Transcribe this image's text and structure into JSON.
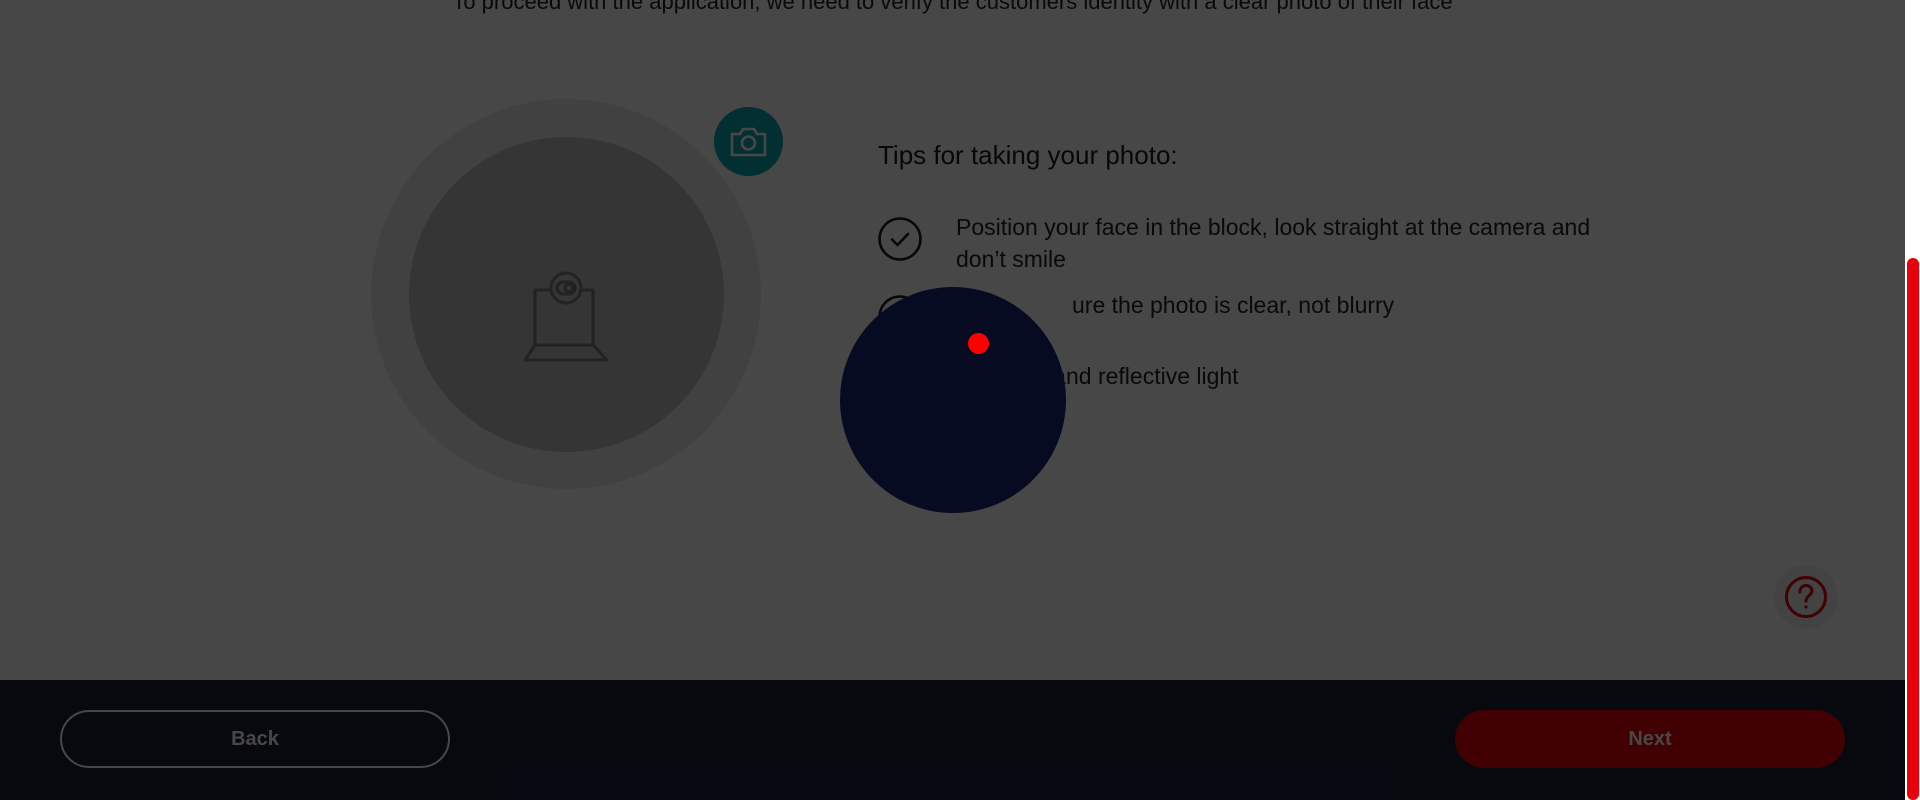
{
  "intro": {
    "text": "To proceed with the application, we need to verify the customers identity with a clear photo of their face"
  },
  "photo": {
    "placeholder_icon": "webcam-laptop-icon",
    "camera_icon": "camera-icon"
  },
  "tips": {
    "title": "Tips for taking your photo:",
    "items": [
      {
        "icon": "check-circle-icon",
        "text": "Position your face in the block, look straight at the camera and don’t smile"
      },
      {
        "icon": "check-circle-icon",
        "text": "ure the photo is clear, not blurry"
      },
      {
        "icon": "check-circle-icon",
        "text": "n and reflective light"
      }
    ]
  },
  "help": {
    "icon": "question-circle-icon"
  },
  "footer": {
    "back_label": "Back",
    "next_label": "Next"
  },
  "colors": {
    "accent_red": "#e8000a",
    "teal": "#0aa8b5",
    "footer_navy": "#1a2038",
    "spotlight_navy": "#060b22"
  }
}
